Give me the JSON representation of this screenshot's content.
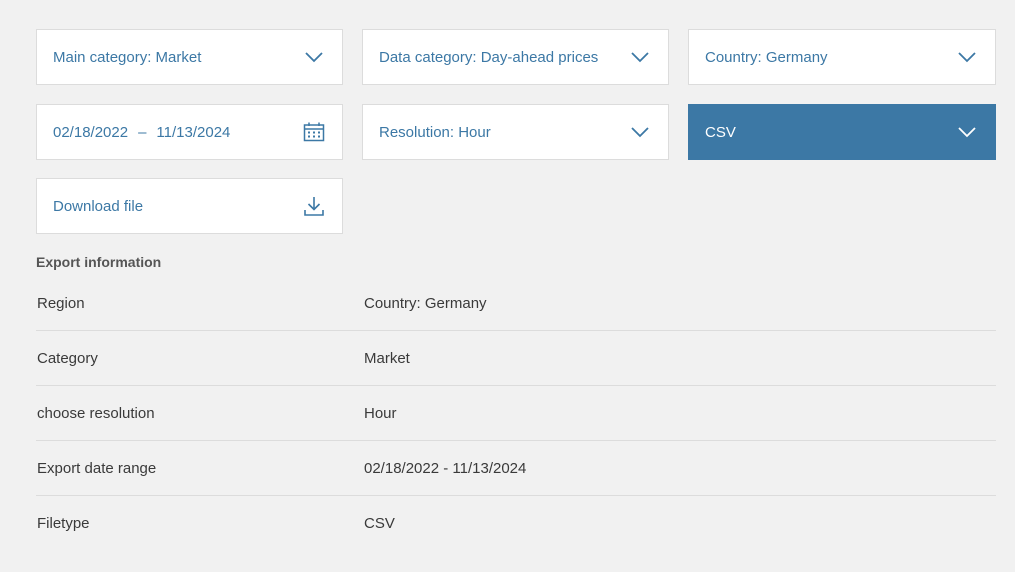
{
  "filters": {
    "main_category": "Main category: Market",
    "data_category": "Data category: Day-ahead prices",
    "country": "Country: Germany",
    "date_start": "02/18/2022",
    "date_sep": "–",
    "date_end": "11/13/2024",
    "resolution": "Resolution: Hour",
    "filetype": "CSV",
    "download": "Download file"
  },
  "export_info": {
    "title": "Export information",
    "rows": [
      {
        "label": "Region",
        "value": "Country: Germany"
      },
      {
        "label": "Category",
        "value": "Market"
      },
      {
        "label": "choose resolution",
        "value": "Hour"
      },
      {
        "label": "Export date range",
        "value": "02/18/2022 - 11/13/2024"
      },
      {
        "label": "Filetype",
        "value": "CSV"
      }
    ]
  },
  "colors": {
    "accent": "#3c78a5",
    "background": "#f1f1f1",
    "panel": "#ffffff",
    "divider": "#dcdcdc"
  },
  "icons": {
    "dropdown": "chevron-down-icon",
    "calendar": "calendar-icon",
    "download": "download-icon"
  }
}
